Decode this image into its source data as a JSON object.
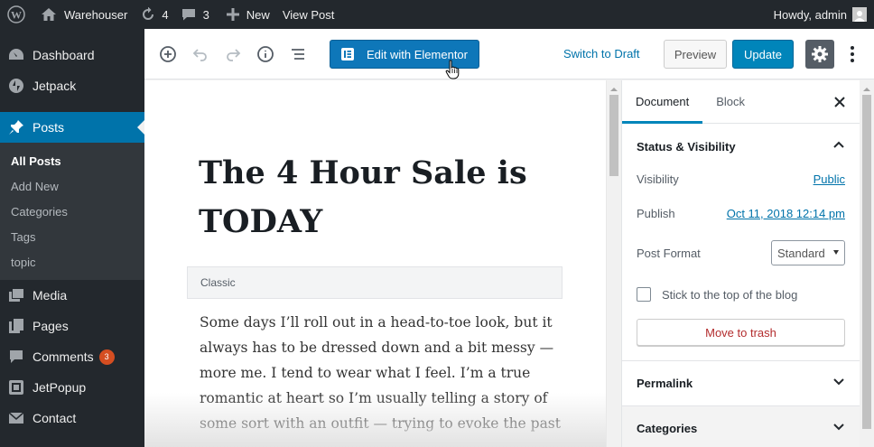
{
  "adminbar": {
    "site_name": "Warehouser",
    "updates_count": "4",
    "comments_count": "3",
    "new_label": "New",
    "view_post_label": "View Post",
    "howdy_label": "Howdy, admin"
  },
  "sidebar": {
    "items": [
      {
        "label": "Dashboard",
        "icon": "dashboard-icon"
      },
      {
        "label": "Jetpack",
        "icon": "jetpack-icon"
      },
      {
        "label": "Posts",
        "icon": "pin-icon"
      },
      {
        "label": "Media",
        "icon": "media-icon"
      },
      {
        "label": "Pages",
        "icon": "pages-icon"
      },
      {
        "label": "Comments",
        "icon": "comments-icon",
        "badge": "3"
      },
      {
        "label": "JetPopup",
        "icon": "jetpopup-icon"
      },
      {
        "label": "Contact",
        "icon": "mail-icon"
      }
    ],
    "posts_submenu": [
      "All Posts",
      "Add New",
      "Categories",
      "Tags",
      "topic"
    ]
  },
  "toolbar": {
    "elementor_label": "Edit with Elementor",
    "switch_draft_label": "Switch to Draft",
    "preview_label": "Preview",
    "update_label": "Update"
  },
  "post": {
    "title": "The 4 Hour Sale is TODAY",
    "classic_label": "Classic",
    "body": "Some days I’ll roll out in a head-to-toe look, but it always has to be dressed down and a bit messy — more me. I tend to wear what I feel. I’m a true romantic at heart so I’m usually telling a story of some sort with an outfit — trying to evoke the past"
  },
  "panel": {
    "tabs": [
      "Document",
      "Block"
    ],
    "status_title": "Status & Visibility",
    "visibility_label": "Visibility",
    "visibility_value": "Public",
    "publish_label": "Publish",
    "publish_value": "Oct 11, 2018 12:14 pm",
    "post_format_label": "Post Format",
    "post_format_value": "Standard",
    "sticky_label": "Stick to the top of the blog",
    "trash_label": "Move to trash",
    "permalink_title": "Permalink",
    "categories_title": "Categories"
  },
  "colors": {
    "admin_dark": "#23282d",
    "accent_blue": "#0073aa",
    "elementor_blue": "#0e77b9",
    "badge_orange": "#d54e21",
    "trash_red": "#b32d2e"
  }
}
